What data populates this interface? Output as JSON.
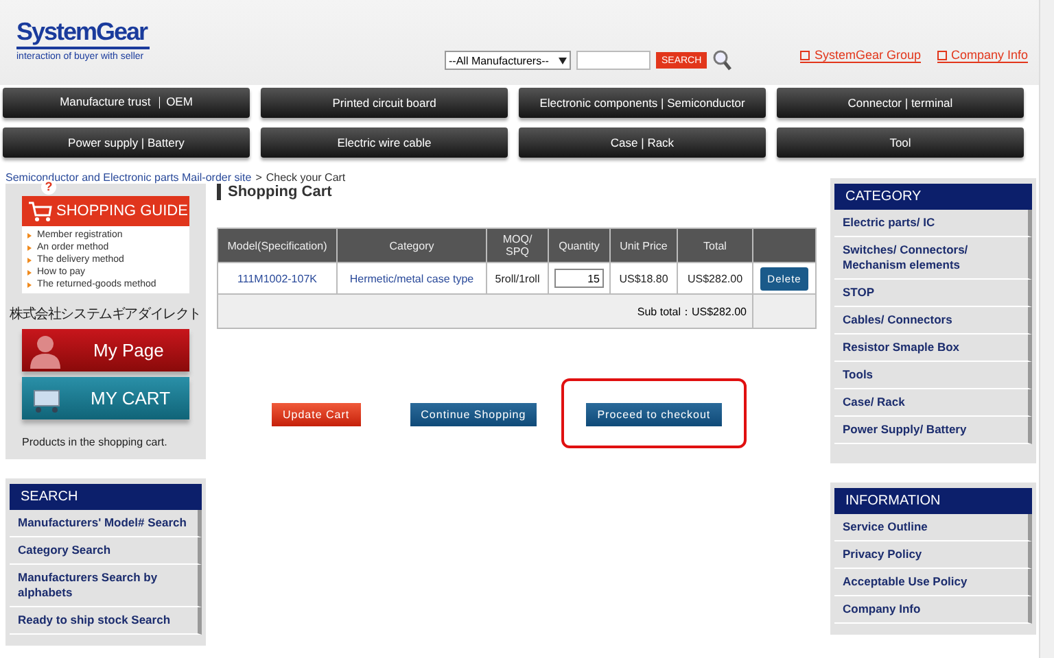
{
  "header": {
    "logo": "SystemGear",
    "tagline": "interaction of buyer with seller",
    "manufacturer_select": "--All Manufacturers--",
    "search_button": "SEARCH",
    "links": [
      "SystemGear Group",
      "Company Info"
    ]
  },
  "nav": [
    "Manufacture trust ｜OEM",
    "Printed circuit board",
    "Electronic components | Semiconductor",
    "Connector | terminal",
    "Power supply | Battery",
    "Electric wire cable",
    "Case | Rack",
    "Tool"
  ],
  "breadcrumb": {
    "link": "Semiconductor and Electronic parts Mail-order site",
    "separator": ">",
    "current": "Check your Cart"
  },
  "shopping_guide": {
    "badge": "?",
    "title": "SHOPPING GUIDE",
    "items": [
      "Member registration",
      "An order method",
      "The delivery method",
      "How to pay",
      "The returned-goods method"
    ]
  },
  "company_name": "株式会社システムギアダイレクト",
  "my_page": "My Page",
  "my_cart": "MY CART",
  "cart_note": "Products in the shopping cart.",
  "search_menu": {
    "title": "SEARCH",
    "items": [
      "Manufacturers' Model# Search",
      "Category Search",
      "Manufacturers Search by alphabets",
      "Ready to ship stock Search"
    ]
  },
  "cart": {
    "title": "Shopping Cart",
    "columns": [
      "Model(Specification)",
      "Category",
      "MOQ/ SPQ",
      "Quantity",
      "Unit Price",
      "Total"
    ],
    "rows": [
      {
        "model": "111M1002-107K",
        "category": "Hermetic/metal case type",
        "moq": "5roll/1roll",
        "quantity": "15",
        "unit_price": "US$18.80",
        "total": "US$282.00",
        "delete": "Delete"
      }
    ],
    "subtotal": "Sub total：US$282.00"
  },
  "actions": [
    {
      "label": "Update Cart",
      "kind": "danger",
      "highlighted": false
    },
    {
      "label": "Continue Shopping",
      "kind": "primary",
      "highlighted": false
    },
    {
      "label": "Proceed to checkout",
      "kind": "primary",
      "highlighted": true
    }
  ],
  "category": {
    "title": "CATEGORY",
    "items": [
      "Electric parts/ IC",
      "Switches/ Connectors/ Mechanism elements",
      "STOP",
      "Cables/ Connectors",
      "Resistor Smaple Box",
      "Tools",
      "Case/ Rack",
      "Power Supply/ Battery"
    ]
  },
  "information": {
    "title": "INFORMATION",
    "items": [
      "Service Outline",
      "Privacy Policy",
      "Acceptable Use Policy",
      "Company Info"
    ]
  }
}
